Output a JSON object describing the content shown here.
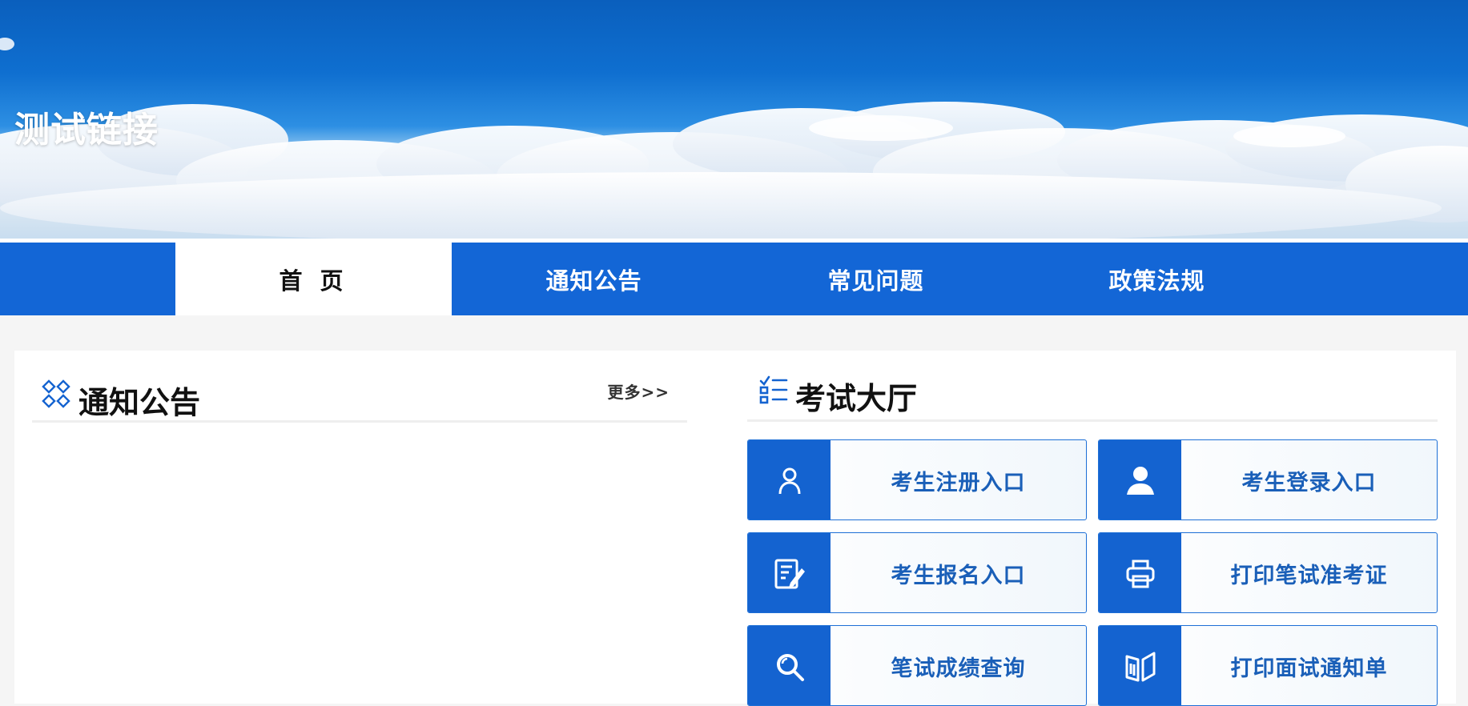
{
  "banner": {
    "title": "测试链接"
  },
  "nav": {
    "items": [
      {
        "label": "首 页",
        "active": true
      },
      {
        "label": "通知公告",
        "active": false
      },
      {
        "label": "常见问题",
        "active": false
      },
      {
        "label": "政策法规",
        "active": false
      }
    ]
  },
  "notices": {
    "title": "通知公告",
    "more": "更多>>",
    "items": []
  },
  "exam_hall": {
    "title": "考试大厅",
    "entries": [
      {
        "label": "考生注册入口",
        "icon": "user-outline-icon"
      },
      {
        "label": "考生登录入口",
        "icon": "user-solid-icon"
      },
      {
        "label": "考生报名入口",
        "icon": "edit-form-icon"
      },
      {
        "label": "打印笔试准考证",
        "icon": "printer-icon"
      },
      {
        "label": "笔试成绩查询",
        "icon": "search-icon"
      },
      {
        "label": "打印面试通知单",
        "icon": "open-book-icon"
      }
    ]
  },
  "colors": {
    "nav_bg": "#1366d6",
    "accent": "#1463d0",
    "entry_text": "#1a5fb8",
    "page_bg": "#f5f5f5"
  }
}
